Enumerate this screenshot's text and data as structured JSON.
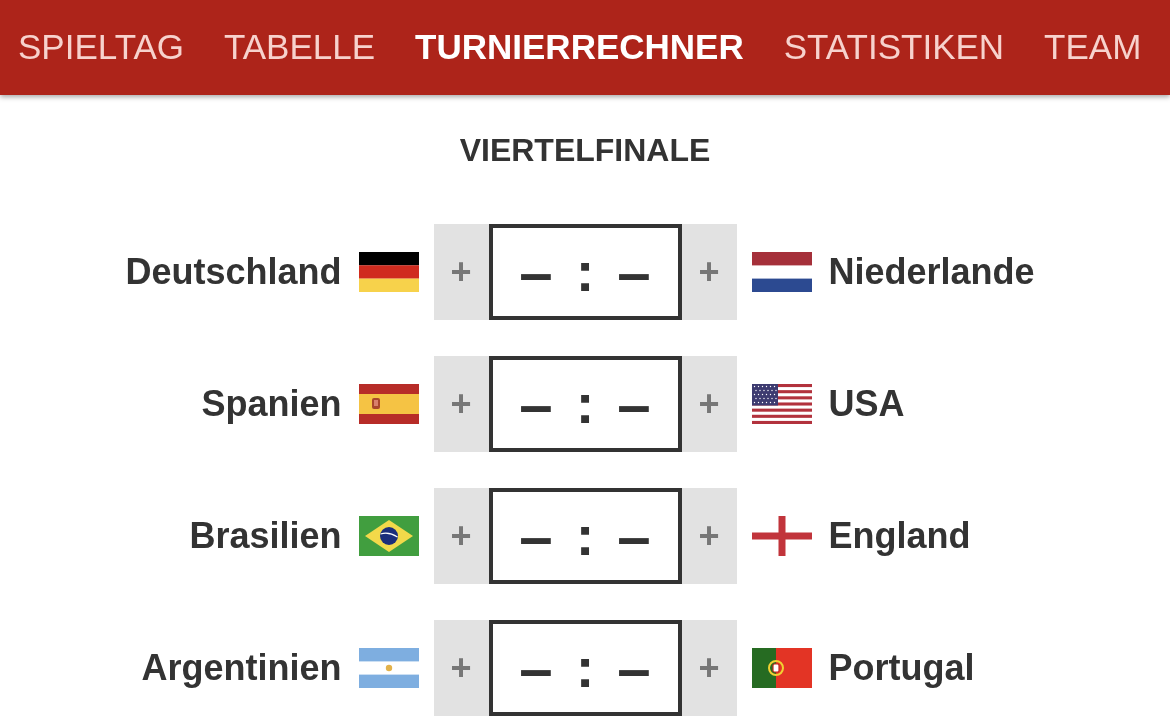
{
  "nav": {
    "tabs": [
      {
        "label": "SPIELTAG",
        "selected": false
      },
      {
        "label": "TABELLE",
        "selected": false
      },
      {
        "label": "TURNIERRECHNER",
        "selected": true
      },
      {
        "label": "STATISTIKEN",
        "selected": false
      },
      {
        "label": "TEAM",
        "selected": false
      }
    ]
  },
  "round": {
    "title": "VIERTELFINALE"
  },
  "matches": [
    {
      "home": {
        "name": "Deutschland"
      },
      "home_plus": "+",
      "home_score": {
        "placeholder": "–"
      },
      "separator": ":",
      "away_score": {
        "placeholder": "–"
      },
      "away_plus": "+",
      "away": {
        "name": "Niederlande"
      }
    },
    {
      "home": {
        "name": "Spanien"
      },
      "home_plus": "+",
      "home_score": {
        "placeholder": "–"
      },
      "separator": ":",
      "away_score": {
        "placeholder": "–"
      },
      "away_plus": "+",
      "away": {
        "name": "USA"
      }
    },
    {
      "home": {
        "name": "Brasilien"
      },
      "home_plus": "+",
      "home_score": {
        "placeholder": "–"
      },
      "separator": ":",
      "away_score": {
        "placeholder": "–"
      },
      "away_plus": "+",
      "away": {
        "name": "England"
      }
    },
    {
      "home": {
        "name": "Argentinien"
      },
      "home_plus": "+",
      "home_score": {
        "placeholder": "–"
      },
      "separator": ":",
      "away_score": {
        "placeholder": "–"
      },
      "away_plus": "+",
      "away": {
        "name": "Portugal"
      }
    }
  ]
}
